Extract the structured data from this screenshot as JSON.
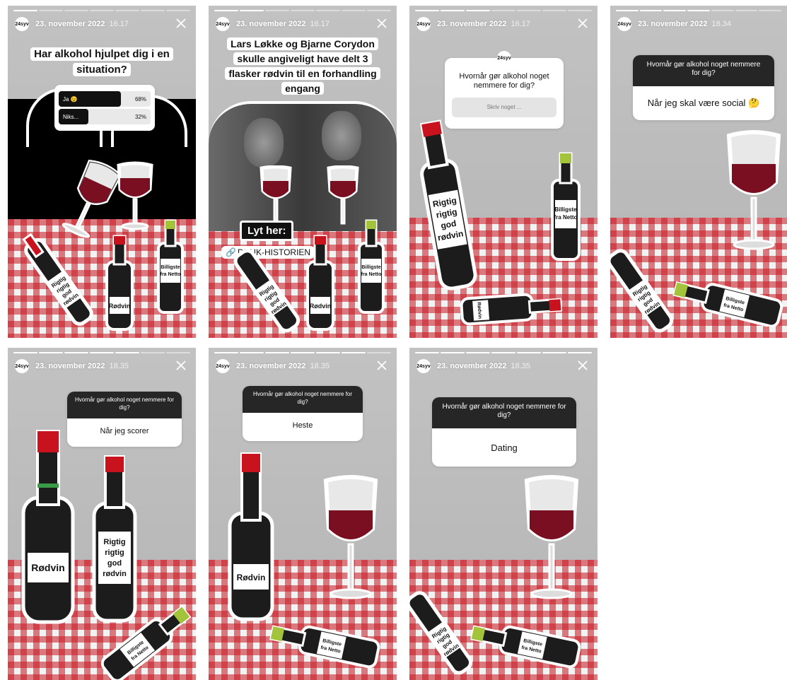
{
  "stories": [
    {
      "date": "23. november 2022",
      "time": "16.17",
      "avatar": "24syv",
      "caption": "Har alkohol hjulpet dig i en situation?",
      "poll": [
        {
          "label": "Ja 😉",
          "pct": "68",
          "unit": "%",
          "fill": 0.68
        },
        {
          "label": "Niks...",
          "pct": "32",
          "unit": "%",
          "fill": 0.32
        }
      ]
    },
    {
      "date": "23. november 2022",
      "time": "16.17",
      "avatar": "24syv",
      "caption": "Lars Løkke og Bjarne Corydon skulle angiveligt have delt 3 flasker rødvin til en forhandling engang",
      "listen": "Lyt her:",
      "link": "DRUK-HISTORIEN"
    },
    {
      "date": "23. november 2022",
      "time": "16.17",
      "avatar": "24syv",
      "question": "Hvornår gør alkohol noget nemmere for dig?",
      "placeholder": "Skriv noget ..."
    },
    {
      "date": "23. november 2022",
      "time": "18.34",
      "avatar": "24syv",
      "question": "Hvornår gør alkohol noget nemmere for dig?",
      "answer": "Når jeg skal være social 🤔"
    },
    {
      "date": "23. november 2022",
      "time": "18.35",
      "avatar": "24syv",
      "question": "Hvornår gør alkohol noget nemmere for dig?",
      "answer": "Når jeg scorer"
    },
    {
      "date": "23. november 2022",
      "time": "18.35",
      "avatar": "24syv",
      "question": "Hvornår gør alkohol noget nemmere for dig?",
      "answer": "Heste"
    },
    {
      "date": "23. november 2022",
      "time": "18.35",
      "avatar": "24syv",
      "question": "Hvornår gør alkohol noget nemmere for dig?",
      "answer": "Dating"
    }
  ],
  "labels": {
    "rodvin": "Rødvin",
    "rigtig_lines": [
      "Rigtig",
      "rigtig",
      "god",
      "rødvin"
    ],
    "billigste_lines": [
      "Billigste",
      "fra Netto"
    ]
  },
  "colors": {
    "wine": "#7a0f22",
    "bottle": "#1c1c1c",
    "foil_red": "#c8131f",
    "foil_green": "#a3c33a",
    "cloth_red": "#c8141e"
  }
}
